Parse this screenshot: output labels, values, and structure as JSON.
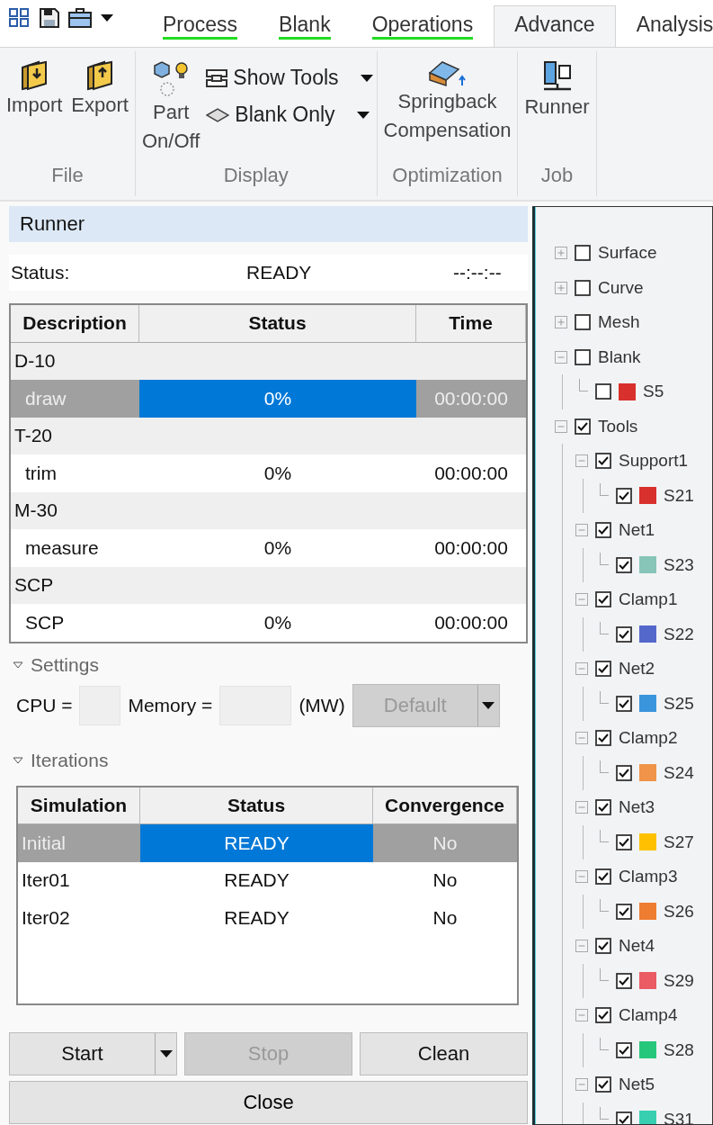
{
  "quick_access": [
    {
      "kind": "grid"
    },
    {
      "kind": "save"
    },
    {
      "kind": "case"
    },
    {
      "kind": "caret"
    }
  ],
  "tabs": [
    {
      "label": "Process",
      "selected": false,
      "completed": true
    },
    {
      "label": "Blank",
      "selected": false,
      "completed": true
    },
    {
      "label": "Operations",
      "selected": false,
      "completed": true
    },
    {
      "label": "Advance",
      "selected": true,
      "completed": false
    },
    {
      "label": "Analysis",
      "selected": false,
      "completed": false
    }
  ],
  "ribbon_groups": [
    {
      "label": "File",
      "buttons": [
        {
          "kind": "large",
          "label": "Import"
        },
        {
          "kind": "large",
          "label": "Export"
        }
      ]
    },
    {
      "label": "Display",
      "buttons": [
        {
          "kind": "large",
          "label": "Part\nOn/Off"
        },
        {
          "kind": "dropdown",
          "label": "Show Tools"
        },
        {
          "kind": "dropdown",
          "label": "Blank Only"
        }
      ]
    },
    {
      "label": "Optimization",
      "buttons": [
        {
          "kind": "large",
          "label": "Springback\nCompensation"
        }
      ]
    },
    {
      "label": "Job",
      "buttons": [
        {
          "kind": "large",
          "label": "Runner"
        }
      ]
    }
  ],
  "runner": {
    "title": "Runner",
    "status_label": "Status:",
    "status": "READY",
    "elapsed": "--:--:--",
    "columns": [
      "Description",
      "Status",
      "Time"
    ],
    "rows": [
      {
        "kind": "group",
        "description": "D-10"
      },
      {
        "kind": "task",
        "description": "draw",
        "status": "0%",
        "time": "00:00:00",
        "selected": true
      },
      {
        "kind": "group",
        "description": "T-20"
      },
      {
        "kind": "task",
        "description": "trim",
        "status": "0%",
        "time": "00:00:00",
        "selected": false
      },
      {
        "kind": "group",
        "description": "M-30"
      },
      {
        "kind": "task",
        "description": "measure",
        "status": "0%",
        "time": "00:00:00",
        "selected": false
      },
      {
        "kind": "group",
        "description": "SCP"
      },
      {
        "kind": "task",
        "description": "SCP",
        "status": "0%",
        "time": "00:00:00",
        "selected": false
      }
    ]
  },
  "settings": {
    "title": "Settings",
    "expanded": true,
    "cpu_label": "CPU =",
    "memory_label": "Memory =",
    "unit": "(MW)",
    "preset": {
      "value": "Default",
      "disabled": true
    }
  },
  "iterations": {
    "title": "Iterations",
    "expanded": true,
    "columns": [
      "Simulation",
      "Status",
      "Convergence"
    ],
    "rows": [
      {
        "simulation": "Initial",
        "status": "READY",
        "convergence": "No",
        "selected": true
      },
      {
        "simulation": "Iter01",
        "status": "READY",
        "convergence": "No",
        "selected": false
      },
      {
        "simulation": "Iter02",
        "status": "READY",
        "convergence": "No",
        "selected": false
      }
    ]
  },
  "buttons": [
    {
      "label": "Start",
      "disabled": false,
      "menu": true
    },
    {
      "label": "Stop",
      "disabled": true,
      "menu": false
    },
    {
      "label": "Clean",
      "disabled": false,
      "menu": false
    }
  ],
  "close_button": "Close",
  "tree": [
    {
      "label": "Surface",
      "checked": false,
      "expanded": false
    },
    {
      "label": "Curve",
      "checked": false,
      "expanded": false
    },
    {
      "label": "Mesh",
      "checked": false,
      "expanded": false
    },
    {
      "label": "Blank",
      "checked": false,
      "expanded": true,
      "children": [
        {
          "label": "S5",
          "checked": false,
          "color": "#d8302c"
        }
      ]
    },
    {
      "label": "Tools",
      "checked": true,
      "expanded": true,
      "children": [
        {
          "label": "Support1",
          "checked": true,
          "expanded": true,
          "children": [
            {
              "label": "S21",
              "checked": true,
              "color": "#d8302c"
            }
          ]
        },
        {
          "label": "Net1",
          "checked": true,
          "expanded": true,
          "children": [
            {
              "label": "S23",
              "checked": true,
              "color": "#86c5b8"
            }
          ]
        },
        {
          "label": "Clamp1",
          "checked": true,
          "expanded": true,
          "children": [
            {
              "label": "S22",
              "checked": true,
              "color": "#5468cc"
            }
          ]
        },
        {
          "label": "Net2",
          "checked": true,
          "expanded": true,
          "children": [
            {
              "label": "S25",
              "checked": true,
              "color": "#3a95dc"
            }
          ]
        },
        {
          "label": "Clamp2",
          "checked": true,
          "expanded": true,
          "children": [
            {
              "label": "S24",
              "checked": true,
              "color": "#ef9448"
            }
          ]
        },
        {
          "label": "Net3",
          "checked": true,
          "expanded": true,
          "children": [
            {
              "label": "S27",
              "checked": true,
              "color": "#fdc102"
            }
          ]
        },
        {
          "label": "Clamp3",
          "checked": true,
          "expanded": true,
          "children": [
            {
              "label": "S26",
              "checked": true,
              "color": "#ef7d31"
            }
          ]
        },
        {
          "label": "Net4",
          "checked": true,
          "expanded": true,
          "children": [
            {
              "label": "S29",
              "checked": true,
              "color": "#ea5b64"
            }
          ]
        },
        {
          "label": "Clamp4",
          "checked": true,
          "expanded": true,
          "children": [
            {
              "label": "S28",
              "checked": true,
              "color": "#27c77b"
            }
          ]
        },
        {
          "label": "Net5",
          "checked": true,
          "expanded": true,
          "children": [
            {
              "label": "S31",
              "checked": true,
              "color": "#37cfb0"
            }
          ]
        }
      ]
    }
  ]
}
